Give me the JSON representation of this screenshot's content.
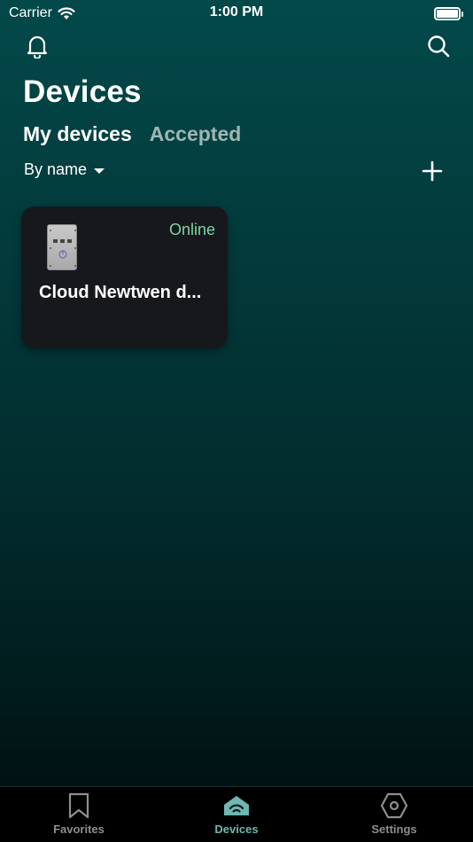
{
  "status_bar": {
    "carrier": "Carrier",
    "time": "1:00 PM"
  },
  "header": {
    "title": "Devices"
  },
  "tabs": [
    {
      "label": "My devices",
      "active": true
    },
    {
      "label": "Accepted",
      "active": false
    }
  ],
  "sort": {
    "label": "By name"
  },
  "devices": [
    {
      "name": "Cloud Newtwen d...",
      "status": "Online"
    }
  ],
  "tab_bar": [
    {
      "label": "Favorites",
      "icon": "bookmark-icon",
      "active": false
    },
    {
      "label": "Devices",
      "icon": "router-icon",
      "active": true
    },
    {
      "label": "Settings",
      "icon": "hexagon-settings-icon",
      "active": false
    }
  ],
  "colors": {
    "accent": "#6fb7b0",
    "online": "#7ed3a6",
    "card_bg": "#17181c"
  }
}
